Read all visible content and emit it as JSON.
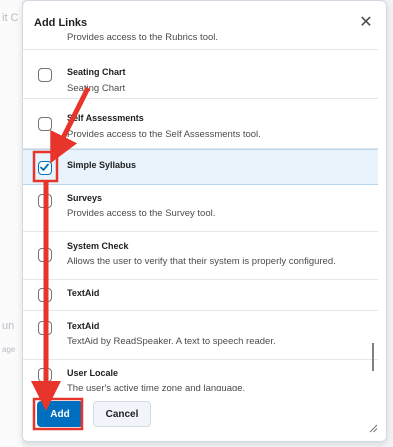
{
  "background": {
    "fragments": [
      "it C",
      "un",
      "age"
    ]
  },
  "dialog": {
    "title": "Add Links",
    "close_icon": "close-icon",
    "items": [
      {
        "name": "",
        "description": "Provides access to the Rubrics tool.",
        "checked": false
      },
      {
        "name": "Seating Chart",
        "description": "Seating Chart",
        "checked": false
      },
      {
        "name": "Self Assessments",
        "description": "Provides access to the Self Assessments tool.",
        "checked": false
      },
      {
        "name": "Simple Syllabus",
        "description": "",
        "checked": true
      },
      {
        "name": "Surveys",
        "description": "Provides access to the Survey tool.",
        "checked": false
      },
      {
        "name": "System Check",
        "description": "Allows the user to verify that their system is properly configured.",
        "checked": false
      },
      {
        "name": "TextAid",
        "description": "",
        "checked": false
      },
      {
        "name": "TextAid",
        "description": "TextAid by ReadSpeaker. A text to speech reader.",
        "checked": false
      },
      {
        "name": "User Locale",
        "description": "The user's active time zone and language.",
        "checked": false
      }
    ],
    "footer": {
      "add_label": "Add",
      "cancel_label": "Cancel"
    }
  },
  "colors": {
    "primary": "#006fbf",
    "annotation": "#e8352b",
    "selected_row": "#e8f3fb"
  }
}
